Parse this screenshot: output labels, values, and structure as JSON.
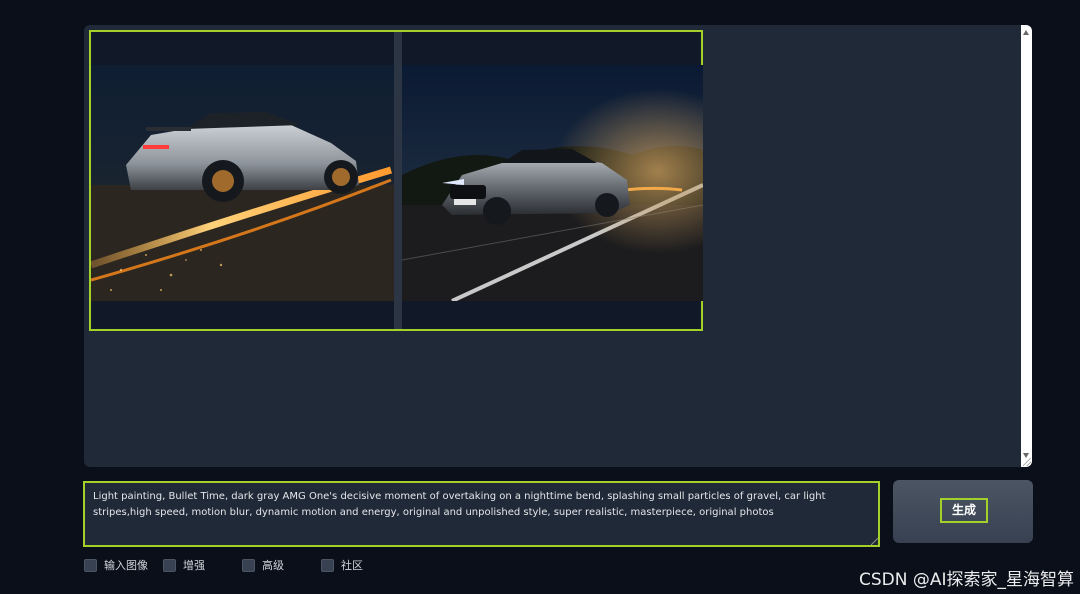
{
  "prompt": {
    "value": "Light painting, Bullet Time, dark gray AMG One's decisive moment of overtaking on a nighttime bend, splashing small particles of gravel, car light stripes,high speed, motion blur, dynamic motion and energy, original and unpolished style, super realistic, masterpiece, original photos"
  },
  "generate_button": {
    "label": "生成"
  },
  "options": [
    {
      "label": "输入图像"
    },
    {
      "label": "增强"
    },
    {
      "label": "高级"
    },
    {
      "label": "社区"
    }
  ],
  "watermark": "CSDN @AI探索家_星海智算",
  "colors": {
    "highlight": "#a3d12a",
    "page_bg": "#0b0f19",
    "panel_bg": "#1f2937"
  }
}
